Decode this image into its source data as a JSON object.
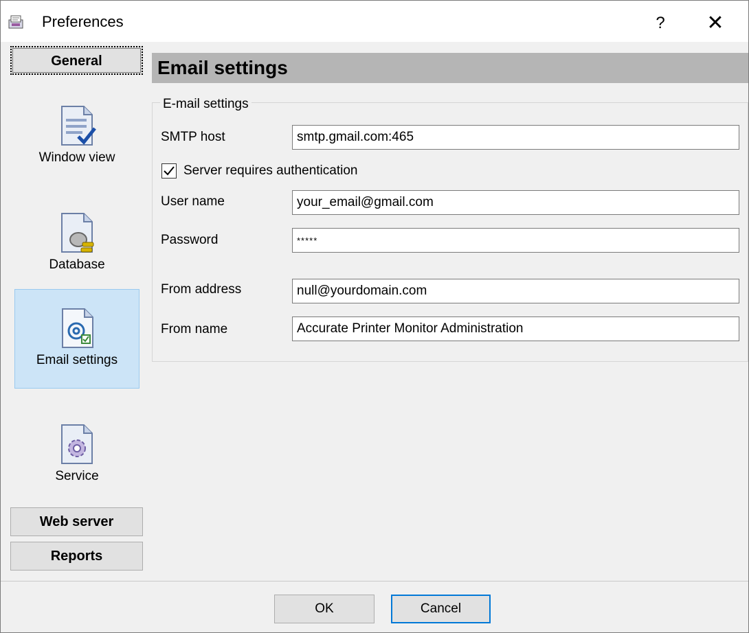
{
  "window": {
    "title": "Preferences",
    "help_glyph": "?",
    "close_glyph": "✕"
  },
  "sidebar": {
    "groups": {
      "general": "General",
      "web_server": "Web server",
      "reports": "Reports"
    },
    "items": [
      {
        "label": "Window view",
        "icon": "window-view-icon",
        "selected": false
      },
      {
        "label": "Database",
        "icon": "database-icon",
        "selected": false
      },
      {
        "label": "Email settings",
        "icon": "email-icon",
        "selected": true
      },
      {
        "label": "Service",
        "icon": "service-gear-icon",
        "selected": false
      }
    ]
  },
  "content": {
    "header": "Email settings",
    "group_title": "E-mail settings",
    "smtp_host": {
      "label": "SMTP host",
      "value": "smtp.gmail.com:465"
    },
    "auth": {
      "label": "Server requires authentication",
      "checked": true
    },
    "user_name": {
      "label": "User name",
      "value": "your_email@gmail.com"
    },
    "password": {
      "label": "Password",
      "value": "*****"
    },
    "from_address": {
      "label": "From address",
      "value": "null@yourdomain.com"
    },
    "from_name": {
      "label": "From name",
      "value": "Accurate Printer Monitor Administration"
    }
  },
  "buttons": {
    "ok": "OK",
    "cancel": "Cancel"
  },
  "colors": {
    "selected_bg": "#cce4f7",
    "header_bg": "#b5b5b5",
    "default_button_border": "#0078d7"
  }
}
